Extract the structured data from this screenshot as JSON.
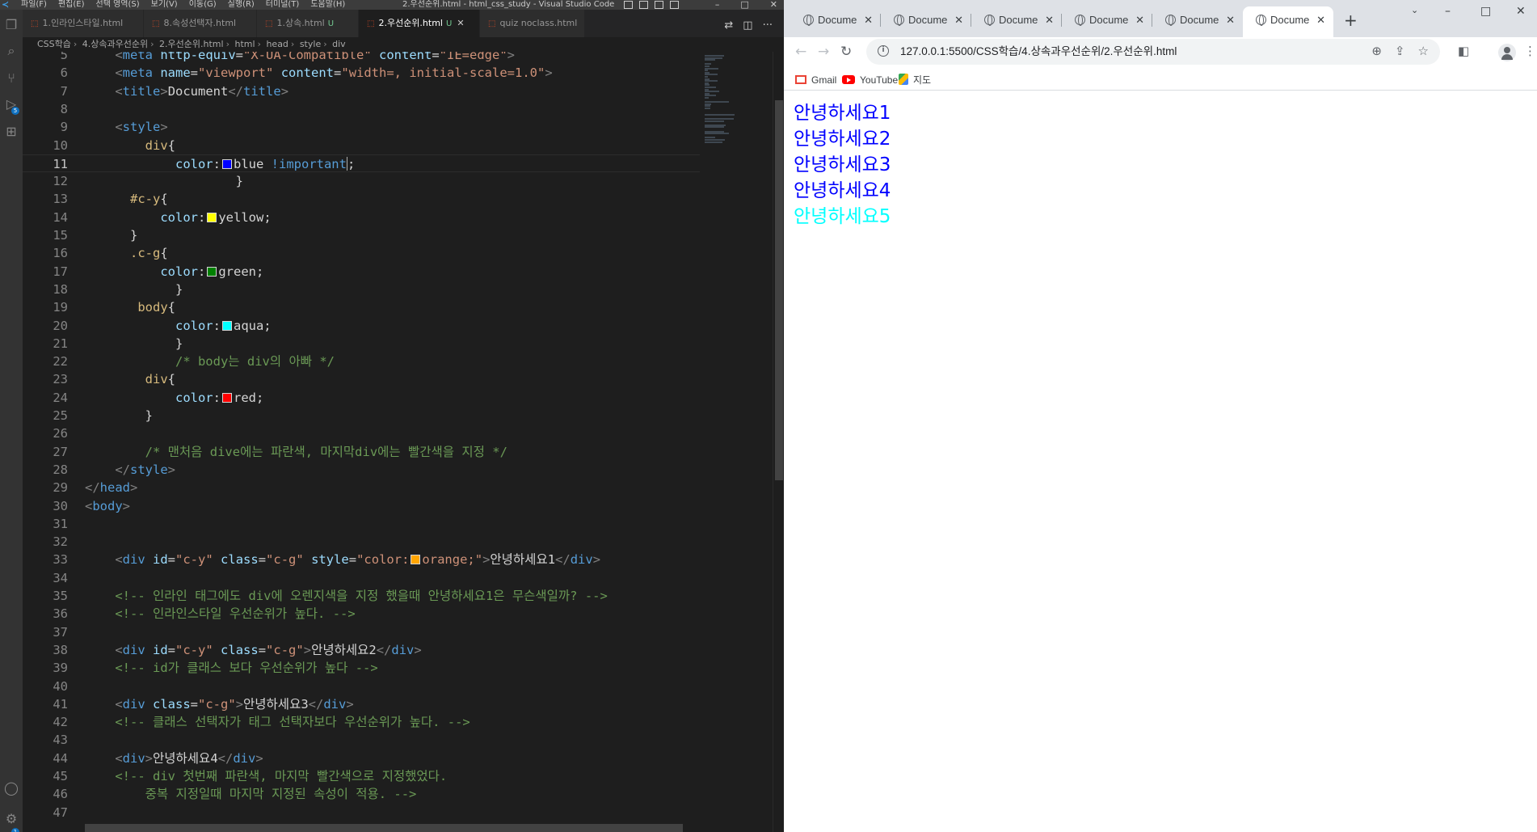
{
  "vscode": {
    "window_title": "2.우선순위.html - html_css_study - Visual Studio Code",
    "menus": [
      "파일(F)",
      "편집(E)",
      "선택 영역(S)",
      "보기(V)",
      "이동(G)",
      "실행(R)",
      "터미널(T)",
      "도움말(H)"
    ],
    "tabs": [
      {
        "label": "1.인라인스타일.html",
        "modified": "",
        "active": false
      },
      {
        "label": "8.속성선택자.html",
        "modified": "",
        "active": false
      },
      {
        "label": "1.상속.html",
        "modified": "U",
        "active": false
      },
      {
        "label": "2.우선순위.html",
        "modified": "U",
        "active": true
      },
      {
        "label": "quiz noclass.html",
        "modified": "",
        "active": false
      }
    ],
    "breadcrumb": [
      "CSS학습",
      "4.상속과우선순위",
      "2.우선순위.html",
      "html",
      "head",
      "style",
      "div"
    ],
    "activity_badges": {
      "source_control": "5",
      "settings": "1"
    },
    "current_line": 11,
    "lines": [
      {
        "n": 5,
        "code": [
          [
            "t-punc",
            "    <"
          ],
          [
            "t-tag",
            "meta "
          ],
          [
            "t-attr",
            "http-equiv"
          ],
          [
            "t-txt",
            "="
          ],
          [
            "t-str",
            "\"X-UA-Compatible\""
          ],
          [
            "t-txt",
            " "
          ],
          [
            "t-attr",
            "content"
          ],
          [
            "t-txt",
            "="
          ],
          [
            "t-str",
            "\"IE=edge\""
          ],
          [
            "t-punc",
            ">"
          ]
        ]
      },
      {
        "n": 6,
        "code": [
          [
            "t-punc",
            "    <"
          ],
          [
            "t-tag",
            "meta "
          ],
          [
            "t-attr",
            "name"
          ],
          [
            "t-txt",
            "="
          ],
          [
            "t-str",
            "\"viewport\""
          ],
          [
            "t-txt",
            " "
          ],
          [
            "t-attr",
            "content"
          ],
          [
            "t-txt",
            "="
          ],
          [
            "t-str",
            "\"width=, initial-scale=1.0\""
          ],
          [
            "t-punc",
            ">"
          ]
        ]
      },
      {
        "n": 7,
        "code": [
          [
            "t-punc",
            "    <"
          ],
          [
            "t-tag",
            "title"
          ],
          [
            "t-punc",
            ">"
          ],
          [
            "t-txt",
            "Document"
          ],
          [
            "t-punc",
            "</"
          ],
          [
            "t-tag",
            "title"
          ],
          [
            "t-punc",
            ">"
          ]
        ]
      },
      {
        "n": 8,
        "code": []
      },
      {
        "n": 9,
        "code": [
          [
            "t-punc",
            "    <"
          ],
          [
            "t-tag",
            "style"
          ],
          [
            "t-punc",
            ">"
          ]
        ]
      },
      {
        "n": 10,
        "code": [
          [
            "t-sel",
            "        div"
          ],
          [
            "t-txt",
            "{"
          ]
        ]
      },
      {
        "n": 11,
        "code": [
          [
            "t-prop",
            "            color"
          ],
          [
            "t-txt",
            ":"
          ],
          [
            "swatch",
            "#0000ff"
          ],
          [
            "t-txt",
            "blue "
          ],
          [
            "t-imp",
            "!important"
          ],
          [
            "t-txt",
            ";"
          ]
        ]
      },
      {
        "n": 12,
        "code": [
          [
            "t-txt",
            "                    }"
          ]
        ]
      },
      {
        "n": 13,
        "code": [
          [
            "t-sel",
            "      #c-y"
          ],
          [
            "t-txt",
            "{"
          ]
        ]
      },
      {
        "n": 14,
        "code": [
          [
            "t-prop",
            "          color"
          ],
          [
            "t-txt",
            ":"
          ],
          [
            "swatch",
            "#ffff00"
          ],
          [
            "t-txt",
            "yellow;"
          ]
        ]
      },
      {
        "n": 15,
        "code": [
          [
            "t-txt",
            "      }"
          ]
        ]
      },
      {
        "n": 16,
        "code": [
          [
            "t-sel",
            "      .c-g"
          ],
          [
            "t-txt",
            "{"
          ]
        ]
      },
      {
        "n": 17,
        "code": [
          [
            "t-prop",
            "          color"
          ],
          [
            "t-txt",
            ":"
          ],
          [
            "swatch",
            "#008000"
          ],
          [
            "t-txt",
            "green;"
          ]
        ]
      },
      {
        "n": 18,
        "code": [
          [
            "t-txt",
            "            }"
          ]
        ]
      },
      {
        "n": 19,
        "code": [
          [
            "t-sel",
            "       body"
          ],
          [
            "t-txt",
            "{"
          ]
        ]
      },
      {
        "n": 20,
        "code": [
          [
            "t-prop",
            "            color"
          ],
          [
            "t-txt",
            ":"
          ],
          [
            "swatch",
            "#00ffff"
          ],
          [
            "t-txt",
            "aqua;"
          ]
        ]
      },
      {
        "n": 21,
        "code": [
          [
            "t-txt",
            "            }"
          ]
        ]
      },
      {
        "n": 22,
        "code": [
          [
            "t-cmt",
            "            /* body는 div의 아빠 */"
          ]
        ]
      },
      {
        "n": 23,
        "code": [
          [
            "t-sel",
            "        div"
          ],
          [
            "t-txt",
            "{"
          ]
        ]
      },
      {
        "n": 24,
        "code": [
          [
            "t-prop",
            "            color"
          ],
          [
            "t-txt",
            ":"
          ],
          [
            "swatch",
            "#ff0000"
          ],
          [
            "t-txt",
            "red;"
          ]
        ]
      },
      {
        "n": 25,
        "code": [
          [
            "t-txt",
            "        }"
          ]
        ]
      },
      {
        "n": 26,
        "code": []
      },
      {
        "n": 27,
        "code": [
          [
            "t-cmt",
            "        /* 맨처음 dive에는 파란색, 마지막div에는 빨간색을 지정 */"
          ]
        ]
      },
      {
        "n": 28,
        "code": [
          [
            "t-punc",
            "    </"
          ],
          [
            "t-tag",
            "style"
          ],
          [
            "t-punc",
            ">"
          ]
        ]
      },
      {
        "n": 29,
        "code": [
          [
            "t-punc",
            "</"
          ],
          [
            "t-tag",
            "head"
          ],
          [
            "t-punc",
            ">"
          ]
        ]
      },
      {
        "n": 30,
        "code": [
          [
            "t-punc",
            "<"
          ],
          [
            "t-tag",
            "body"
          ],
          [
            "t-punc",
            ">"
          ]
        ]
      },
      {
        "n": 31,
        "code": []
      },
      {
        "n": 32,
        "code": []
      },
      {
        "n": 33,
        "code": [
          [
            "t-punc",
            "    <"
          ],
          [
            "t-tag",
            "div "
          ],
          [
            "t-attr",
            "id"
          ],
          [
            "t-txt",
            "="
          ],
          [
            "t-str",
            "\"c-y\""
          ],
          [
            "t-txt",
            " "
          ],
          [
            "t-attr",
            "class"
          ],
          [
            "t-txt",
            "="
          ],
          [
            "t-str",
            "\"c-g\""
          ],
          [
            "t-txt",
            " "
          ],
          [
            "t-attr",
            "style"
          ],
          [
            "t-txt",
            "="
          ],
          [
            "t-str",
            "\"color:"
          ],
          [
            "swatch",
            "#ffa500"
          ],
          [
            "t-str",
            "orange;\""
          ],
          [
            "t-punc",
            ">"
          ],
          [
            "t-txt",
            "안녕하세요1"
          ],
          [
            "t-punc",
            "</"
          ],
          [
            "t-tag",
            "div"
          ],
          [
            "t-punc",
            ">"
          ]
        ]
      },
      {
        "n": 34,
        "code": []
      },
      {
        "n": 35,
        "code": [
          [
            "t-cmt",
            "    <!-- 인라인 태그에도 div에 오렌지색을 지정 했을때 안녕하세요1은 무슨색일까? -->"
          ]
        ]
      },
      {
        "n": 36,
        "code": [
          [
            "t-cmt",
            "    <!-- 인라인스타일 우선순위가 높다. -->"
          ]
        ]
      },
      {
        "n": 37,
        "code": []
      },
      {
        "n": 38,
        "code": [
          [
            "t-punc",
            "    <"
          ],
          [
            "t-tag",
            "div "
          ],
          [
            "t-attr",
            "id"
          ],
          [
            "t-txt",
            "="
          ],
          [
            "t-str",
            "\"c-y\""
          ],
          [
            "t-txt",
            " "
          ],
          [
            "t-attr",
            "class"
          ],
          [
            "t-txt",
            "="
          ],
          [
            "t-str",
            "\"c-g\""
          ],
          [
            "t-punc",
            ">"
          ],
          [
            "t-txt",
            "안녕하세요2"
          ],
          [
            "t-punc",
            "</"
          ],
          [
            "t-tag",
            "div"
          ],
          [
            "t-punc",
            ">"
          ]
        ]
      },
      {
        "n": 39,
        "code": [
          [
            "t-cmt",
            "    <!-- id가 클래스 보다 우선순위가 높다 -->"
          ]
        ]
      },
      {
        "n": 40,
        "code": []
      },
      {
        "n": 41,
        "code": [
          [
            "t-punc",
            "    <"
          ],
          [
            "t-tag",
            "div "
          ],
          [
            "t-attr",
            "class"
          ],
          [
            "t-txt",
            "="
          ],
          [
            "t-str",
            "\"c-g\""
          ],
          [
            "t-punc",
            ">"
          ],
          [
            "t-txt",
            "안녕하세요3"
          ],
          [
            "t-punc",
            "</"
          ],
          [
            "t-tag",
            "div"
          ],
          [
            "t-punc",
            ">"
          ]
        ]
      },
      {
        "n": 42,
        "code": [
          [
            "t-cmt",
            "    <!-- 클래스 선택자가 태그 선택자보다 우선순위가 높다. -->"
          ]
        ]
      },
      {
        "n": 43,
        "code": []
      },
      {
        "n": 44,
        "code": [
          [
            "t-punc",
            "    <"
          ],
          [
            "t-tag",
            "div"
          ],
          [
            "t-punc",
            ">"
          ],
          [
            "t-txt",
            "안녕하세요4"
          ],
          [
            "t-punc",
            "</"
          ],
          [
            "t-tag",
            "div"
          ],
          [
            "t-punc",
            ">"
          ]
        ]
      },
      {
        "n": 45,
        "code": [
          [
            "t-cmt",
            "    <!-- div 첫번째 파란색, 마지막 빨간색으로 지정했었다."
          ]
        ]
      },
      {
        "n": 46,
        "code": [
          [
            "t-cmt",
            "        중복 지정일때 마지막 지정된 속성이 적용. -->"
          ]
        ]
      },
      {
        "n": 47,
        "code": []
      }
    ]
  },
  "chrome": {
    "tabs": [
      "Docume",
      "Docume",
      "Docume",
      "Docume",
      "Docume",
      "Docume"
    ],
    "active_tab": 5,
    "url": "127.0.0.1:5500/CSS학습/4.상속과우선순위/2.우선순위.html",
    "bookmarks": [
      "Gmail",
      "YouTube",
      "지도"
    ],
    "page": {
      "lines": [
        {
          "text": "안녕하세요1",
          "color": "#0000ff"
        },
        {
          "text": "안녕하세요2",
          "color": "#0000ff"
        },
        {
          "text": "안녕하세요3",
          "color": "#0000ff"
        },
        {
          "text": "안녕하세요4",
          "color": "#0000ff"
        },
        {
          "text": "안녕하세요5",
          "color": "#00ffff"
        }
      ]
    }
  }
}
